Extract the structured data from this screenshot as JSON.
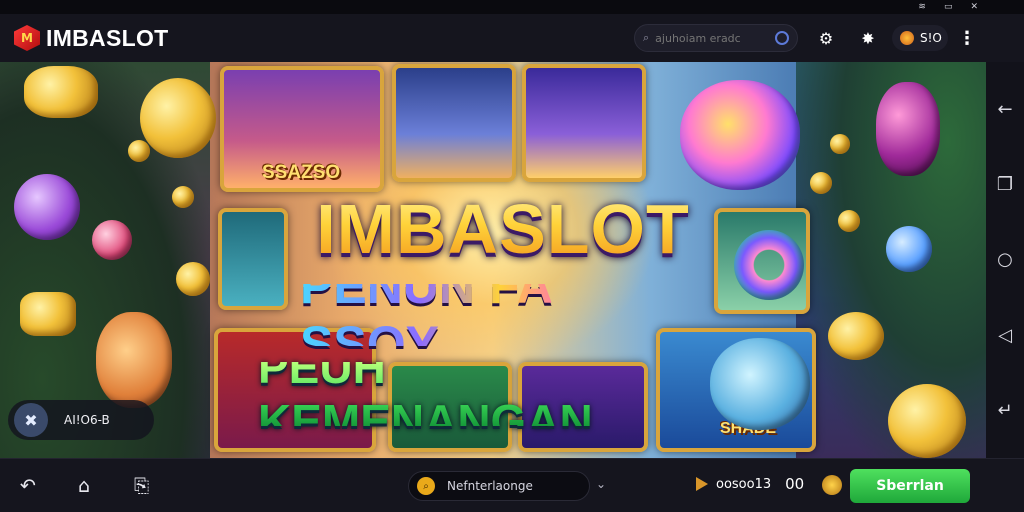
{
  "statusbar": {
    "wifi": "≋",
    "battery": "▭",
    "close": "✕"
  },
  "header": {
    "logo_mark": "M",
    "logo_text": "IMBASLOT",
    "search_placeholder": "ajuhoiam eradc",
    "coin_value": "S!O"
  },
  "banner": {
    "title": "IMBASLOT",
    "subtitle1": "PENUN FA SSOY",
    "subtitle2": "PEUH KEMENANGAN",
    "card_label_1": "SSAZSO",
    "card_label_2": "SHADE",
    "user_chip_text": "AI!O6-B"
  },
  "bottom": {
    "search_value": "Nefnterlaonge",
    "balance_label": "oosoo13",
    "balance_value": "00",
    "cta_label": "Sberrlan"
  },
  "colors": {
    "accent_green": "#2fc44a",
    "brand_red": "#e02a2a",
    "gold": "#ffd23a"
  }
}
